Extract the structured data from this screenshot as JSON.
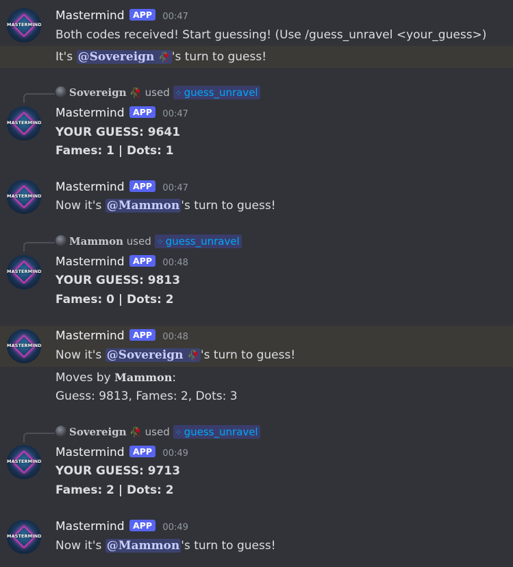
{
  "bot": {
    "name": "Mastermind",
    "badge": "APP",
    "avatar_text": "MASTERMIND"
  },
  "colors": {
    "background": "#313338",
    "highlight": "#3c3a36",
    "badge": "#5865f2",
    "mention_bg": "#3c4270",
    "mention_text": "#c9cdfb",
    "command_text": "#00a8fc"
  },
  "icons": {
    "rose": "rose-emoji",
    "command": "slash-command-icon"
  },
  "messages": [
    {
      "time": "00:47",
      "text": "Both codes received! Start guessing! (Use /guess_unravel <your_guess>)",
      "turn_prefix": "It's ",
      "turn_mention": "@Sovereign",
      "turn_suffix": "'s turn to guess!"
    },
    {
      "reply_user": "Sovereign",
      "reply_used": "used",
      "reply_command": "guess_unravel",
      "time": "00:47",
      "guess": "YOUR GUESS: 9641",
      "result": "Fames: 1 | Dots: 1"
    },
    {
      "time": "00:47",
      "turn_prefix": "Now it's ",
      "turn_mention": "@Mammon",
      "turn_suffix": "'s turn to guess!"
    },
    {
      "reply_user": "Mammon",
      "reply_used": "used",
      "reply_command": "guess_unravel",
      "time": "00:48",
      "guess": "YOUR GUESS: 9813",
      "result": "Fames: 0 | Dots: 2"
    },
    {
      "time": "00:48",
      "turn_prefix": "Now it's ",
      "turn_mention": "@Sovereign",
      "turn_suffix": "'s turn to guess!",
      "moves_prefix": "Moves by ",
      "moves_user": "Mammon",
      "moves_suffix": ":",
      "moves_detail": "Guess: 9813, Fames: 2, Dots: 3"
    },
    {
      "reply_user": "Sovereign",
      "reply_used": "used",
      "reply_command": "guess_unravel",
      "time": "00:49",
      "guess": "YOUR GUESS: 9713",
      "result": "Fames: 2 | Dots: 2"
    },
    {
      "time": "00:49",
      "turn_prefix": "Now it's ",
      "turn_mention": "@Mammon",
      "turn_suffix": "'s turn to guess!"
    }
  ]
}
